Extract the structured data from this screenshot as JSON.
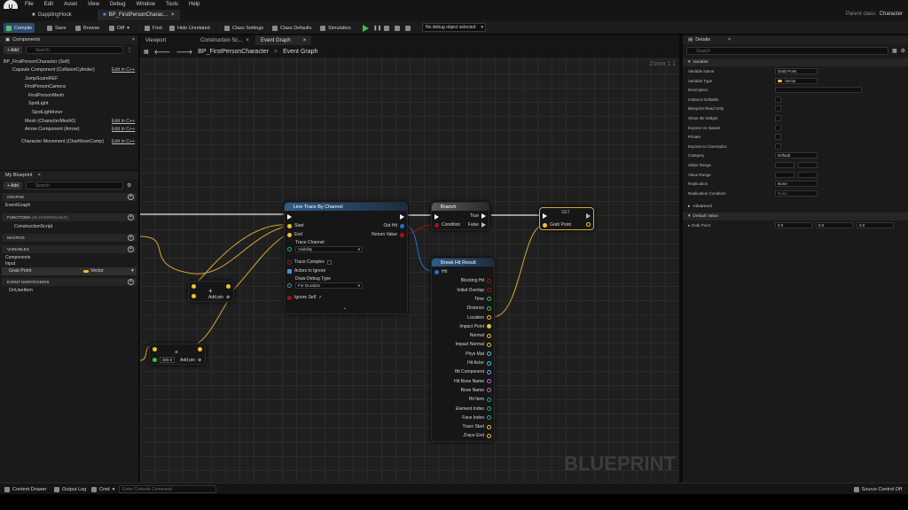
{
  "menu": {
    "items": [
      "File",
      "Edit",
      "Asset",
      "View",
      "Debug",
      "Window",
      "Tools",
      "Help"
    ]
  },
  "tabs": [
    "GapplingHook",
    "BP_FirstPersonCharac..."
  ],
  "parent_class": {
    "label": "Parent class:",
    "value": "Character"
  },
  "toolbar": {
    "compile": "Compile",
    "save": "Save",
    "browse": "Browse",
    "diff": "Diff",
    "find": "Find",
    "hide_unrelated": "Hide Unrelated",
    "class_settings": "Class Settings",
    "class_defaults": "Class Defaults",
    "simulation": "Simulation",
    "debug_object": "No debug object selected"
  },
  "components": {
    "title": "Components",
    "add": "+ Add",
    "search_placeholder": "Search",
    "items": [
      "BP_FirstPersonCharacter (Self)",
      "Capsule Component (CollisionCylinder)",
      "JumpScareREF",
      "FirstPersonCamera",
      "FirstPersonMesh",
      "SpotLight",
      "SpotLightInner",
      "Mesh (CharacterMesh0)",
      "Arrow Component (Arrow)",
      "Character Movement (CharMoveComp)"
    ],
    "edit_in_cpp": "Edit in C++"
  },
  "my_blueprint": {
    "title": "My Blueprint",
    "add": "+ Add",
    "search_placeholder": "Search",
    "graphs": "GRAPHS",
    "event_graph": "EventGraph",
    "functions": "FUNCTIONS",
    "functions_note": "(26 OVERRIDABLE)",
    "construction": "ConstructionScript",
    "macros": "MACROS",
    "variables": "VARIABLES",
    "components": "Components",
    "input": "Input",
    "grab_point": "Grab Point",
    "grab_point_type": "Vector",
    "dispatchers": "EVENT DISPATCHERS",
    "onuseitem": "OnUseItem"
  },
  "editor_tabs": [
    "Viewport",
    "Construction Sc...",
    "Event Graph"
  ],
  "breadcrumb": {
    "root": "BP_FirstPersonCharacter",
    "sep": ">",
    "leaf": "Event Graph"
  },
  "zoom": "Zoom 1:1",
  "watermark": "BLUEPRINT",
  "nodes": {
    "line_trace": {
      "title": "Line Trace By Channel",
      "start": "Start",
      "end": "End",
      "trace_channel": "Trace Channel",
      "trace_channel_value": "Visibility",
      "trace_complex": "Trace Complex",
      "actors_to_ignore": "Actors to Ignore",
      "draw_debug_type": "Draw Debug Type",
      "draw_debug_value": "For Duration",
      "ignore_self": "Ignore Self",
      "out_hit": "Out Hit",
      "return_value": "Return Value"
    },
    "branch": {
      "title": "Branch",
      "condition": "Condition",
      "true": "True",
      "false": "False"
    },
    "set": {
      "title": "SET",
      "grab_point": "Grab Point"
    },
    "add_pin_1": "Add pin",
    "add_pin_2": "Add pin",
    "bool_value": "300.0",
    "break_hit": {
      "title": "Break Hit Result",
      "hit": "Hit",
      "outputs": [
        "Blocking Hit",
        "Initial Overlap",
        "Time",
        "Distance",
        "Location",
        "Impact Point",
        "Normal",
        "Impact Normal",
        "Phys Mat",
        "Hit Actor",
        "Hit Component",
        "Hit Bone Name",
        "Bone Name",
        "Hit Item",
        "Element Index",
        "Face Index",
        "Trace Start",
        "Trace End"
      ]
    }
  },
  "details": {
    "title": "Details",
    "search_placeholder": "Search",
    "variable_section": "Variable",
    "rows": [
      {
        "label": "Variable Name",
        "value": "Grab Point"
      },
      {
        "label": "Variable Type",
        "value": "Vector"
      },
      {
        "label": "Description",
        "value": ""
      },
      {
        "label": "Instance Editable",
        "value": ""
      },
      {
        "label": "Blueprint Read Only",
        "value": ""
      },
      {
        "label": "Show 3D Widget",
        "value": ""
      },
      {
        "label": "Expose on Spawn",
        "value": ""
      },
      {
        "label": "Private",
        "value": ""
      },
      {
        "label": "Expose to Cinematics",
        "value": ""
      },
      {
        "label": "Category",
        "value": "Default"
      },
      {
        "label": "Slider Range",
        "value": ""
      },
      {
        "label": "Value Range",
        "value": ""
      },
      {
        "label": "Replication",
        "value": "None"
      },
      {
        "label": "Replication Condition",
        "value": "None"
      }
    ],
    "advanced": "Advanced",
    "default_value": "Default Value",
    "grab_point_label": "Grab Point",
    "grab_xyz": [
      "0.0",
      "0.0",
      "0.0"
    ]
  },
  "status": {
    "content_drawer": "Content Drawer",
    "output_log": "Output Log",
    "cmd": "Cmd",
    "cmd_placeholder": "Enter Console Command",
    "source_control": "Source Control Off"
  },
  "colors": {
    "exec": "#ffffff",
    "vector_pin": "#f2c12e",
    "struct_pin": "#1e6fd9",
    "bool_pin": "#a01515",
    "node_trace_header": "#2f5d8a",
    "node_branch_header": "#4d4d4d",
    "set_border": "#d6a630"
  }
}
